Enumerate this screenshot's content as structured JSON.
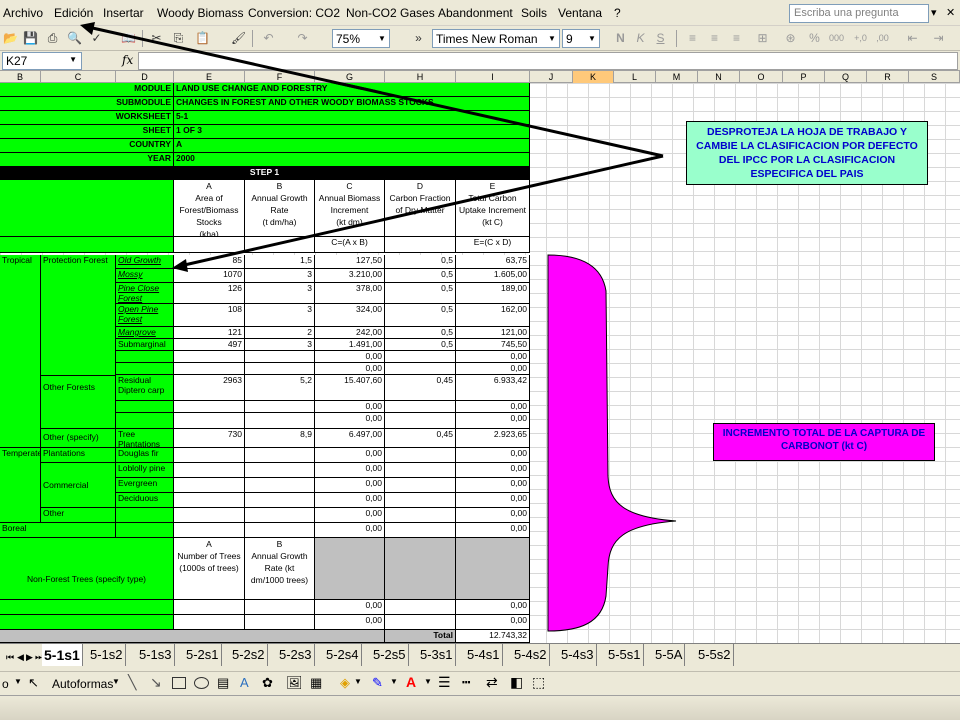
{
  "menu": {
    "items": [
      "Archivo",
      "Edición",
      "Insertar",
      "Woody Biomass",
      "Conversion: CO2",
      "Non-CO2 Gases",
      "Abandonment",
      "Soils",
      "Ventana",
      "?"
    ],
    "ask_placeholder": "Escriba una pregunta"
  },
  "toolbar": {
    "zoom": "75%",
    "font": "Times New Roman",
    "size": "9"
  },
  "formula": {
    "cell": "K27",
    "fx": "fx"
  },
  "columns": [
    "B",
    "C",
    "D",
    "E",
    "F",
    "G",
    "H",
    "I",
    "J",
    "K",
    "L",
    "M",
    "N",
    "O",
    "P",
    "Q",
    "R",
    "S"
  ],
  "header": {
    "rows": [
      {
        "label": "MODULE",
        "value": "LAND USE CHANGE AND FORESTRY"
      },
      {
        "label": "SUBMODULE",
        "value": "CHANGES IN FOREST AND OTHER WOODY BIOMASS STOCKS"
      },
      {
        "label": "WORKSHEET",
        "value": "5-1"
      },
      {
        "label": "SHEET",
        "value": "1 OF 3"
      },
      {
        "label": "COUNTRY",
        "value": "A"
      },
      {
        "label": "YEAR",
        "value": "2000"
      }
    ],
    "step": "STEP 1"
  },
  "col_titles": {
    "A": {
      "letter": "A",
      "text": "Area of Forest/Biomass Stocks",
      "unit": "(kha)"
    },
    "B": {
      "letter": "B",
      "text": "Annual Growth Rate",
      "unit": "(t dm/ha)"
    },
    "C": {
      "letter": "C",
      "text": "Annual Biomass Increment",
      "unit": "(kt dm)",
      "formula": "C=(A x B)"
    },
    "D": {
      "letter": "D",
      "text": "Carbon Fraction of Dry Matter",
      "unit": ""
    },
    "E": {
      "letter": "E",
      "text": "Total Carbon Uptake Increment",
      "unit": "(kt C)",
      "formula": "E=(C x D)"
    }
  },
  "rows": [
    {
      "c1": "Tropical",
      "c2": "Protection Forest",
      "c3": "Old Growth",
      "a": "85",
      "b": "1,5",
      "c": "127,50",
      "d": "0,5",
      "e": "63,75"
    },
    {
      "c1": "",
      "c2": "",
      "c3": "Mossy",
      "a": "1070",
      "b": "3",
      "c": "3.210,00",
      "d": "0,5",
      "e": "1.605,00"
    },
    {
      "c1": "",
      "c2": "",
      "c3": "Pine Close Forest",
      "a": "126",
      "b": "3",
      "c": "378,00",
      "d": "0,5",
      "e": "189,00"
    },
    {
      "c1": "",
      "c2": "",
      "c3": "Open Pine Forest",
      "a": "108",
      "b": "3",
      "c": "324,00",
      "d": "0,5",
      "e": "162,00"
    },
    {
      "c1": "",
      "c2": "",
      "c3": "Mangrove",
      "a": "121",
      "b": "2",
      "c": "242,00",
      "d": "0,5",
      "e": "121,00"
    },
    {
      "c1": "",
      "c2": "",
      "c3": "Submarginal",
      "a": "497",
      "b": "3",
      "c": "1.491,00",
      "d": "0,5",
      "e": "745,50"
    },
    {
      "c1": "",
      "c2": "",
      "c3": "",
      "a": "",
      "b": "",
      "c": "0,00",
      "d": "",
      "e": "0,00"
    },
    {
      "c1": "",
      "c2": "",
      "c3": "",
      "a": "",
      "b": "",
      "c": "0,00",
      "d": "",
      "e": "0,00"
    },
    {
      "c1": "",
      "c2": "Other Forests",
      "c3": "Residual Diptero carp",
      "a": "2963",
      "b": "5,2",
      "c": "15.407,60",
      "d": "0,45",
      "e": "6.933,42"
    },
    {
      "c1": "",
      "c2": "",
      "c3": "",
      "a": "",
      "b": "",
      "c": "0,00",
      "d": "",
      "e": "0,00"
    },
    {
      "c1": "",
      "c2": "",
      "c3": "",
      "a": "",
      "b": "",
      "c": "0,00",
      "d": "",
      "e": "0,00"
    },
    {
      "c1": "",
      "c2": "Other (specify)",
      "c3": "Tree Plantations",
      "a": "730",
      "b": "8,9",
      "c": "6.497,00",
      "d": "0,45",
      "e": "2.923,65"
    },
    {
      "c1": "Temperate",
      "c2": "Plantations",
      "c3": "Douglas fir",
      "a": "",
      "b": "",
      "c": "0,00",
      "d": "",
      "e": "0,00"
    },
    {
      "c1": "",
      "c2": "",
      "c3": "Loblolly pine",
      "a": "",
      "b": "",
      "c": "0,00",
      "d": "",
      "e": "0,00"
    },
    {
      "c1": "",
      "c2": "Commercial",
      "c3": "Evergreen",
      "a": "",
      "b": "",
      "c": "0,00",
      "d": "",
      "e": "0,00"
    },
    {
      "c1": "",
      "c2": "",
      "c3": "Deciduous",
      "a": "",
      "b": "",
      "c": "0,00",
      "d": "",
      "e": "0,00"
    },
    {
      "c1": "",
      "c2": "Other",
      "c3": "",
      "a": "",
      "b": "",
      "c": "0,00",
      "d": "",
      "e": "0,00"
    },
    {
      "c1": "Boreal",
      "c2": "",
      "c3": "",
      "a": "",
      "b": "",
      "c": "0,00",
      "d": "",
      "e": "0,00"
    }
  ],
  "nonforest": {
    "label": "Non-Forest Trees (specify type)",
    "a_letter": "A",
    "a_text": "Number of Trees (1000s of trees)",
    "b_letter": "B",
    "b_text": "Annual Growth Rate (kt dm/1000 trees)",
    "rows": [
      {
        "c": "0,00",
        "e": "0,00"
      },
      {
        "c": "0,00",
        "e": "0,00"
      }
    ]
  },
  "total": {
    "label": "Total",
    "value": "12.743,32"
  },
  "callouts": {
    "top": "DESPROTEJA LA HOJA DE TRABAJO Y CAMBIE LA CLASIFICACION POR DEFECTO DEL IPCC POR LA CLASIFICACION ESPECIFICA DEL PAIS",
    "bottom": "INCREMENTO TOTAL DE LA CAPTURA DE CARBONOT (kt C)"
  },
  "tabs": [
    "5-1s1",
    "5-1s2",
    "5-1s3",
    "5-2s1",
    "5-2s2",
    "5-2s3",
    "5-2s4",
    "5-2s5",
    "5-3s1",
    "5-4s1",
    "5-4s2",
    "5-4s3",
    "5-5s1",
    "5-5A",
    "5-5s2"
  ],
  "drawbar": {
    "draw": "o",
    "autoshapes": "Autoformas"
  },
  "colors": {
    "green": "#00ff00",
    "magenta": "#ff00ff",
    "callout": "#99ffcc",
    "callout_text": "#0000cc"
  }
}
